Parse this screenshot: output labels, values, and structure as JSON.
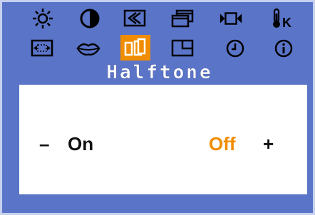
{
  "menu": {
    "icons_row1": [
      "brightness-icon",
      "contrast-icon",
      "image-position-icon",
      "window-icon",
      "video-icon",
      "color-temperature-icon"
    ],
    "icons_row2": [
      "image-size-icon",
      "lips-icon",
      "halftone-icon",
      "pip-icon",
      "clock-icon",
      "information-icon"
    ],
    "selected": "halftone-icon",
    "temp_icon_letter": "K"
  },
  "submenu": {
    "title": "Halftone",
    "decrease": "–",
    "option_on": "On",
    "option_off": "Off",
    "increase": "+",
    "selected_option": "Off"
  },
  "colors": {
    "background": "#5a74c8",
    "highlight": "#f08c00",
    "panel": "#ffffff"
  }
}
